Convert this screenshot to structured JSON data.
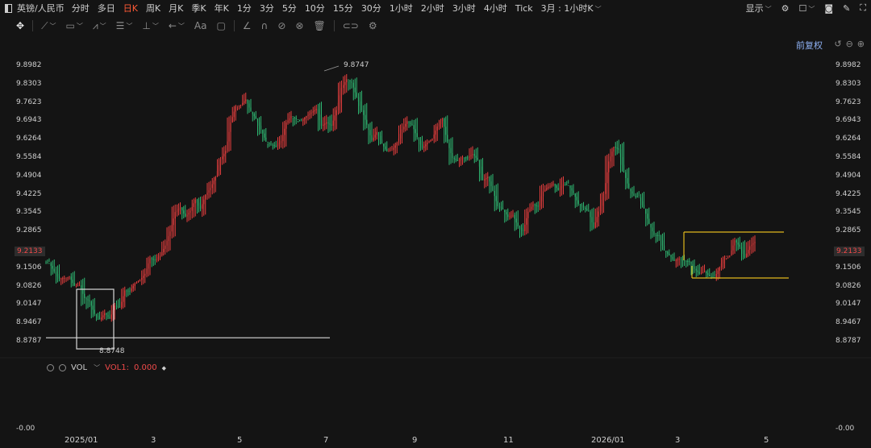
{
  "topbar": {
    "symbol": "英镑/人民币",
    "periods": [
      "分时",
      "多日",
      "日K",
      "周K",
      "月K",
      "季K",
      "年K",
      "1分",
      "3分",
      "5分",
      "10分",
      "15分",
      "30分",
      "1小时",
      "2小时",
      "3小时",
      "4小时",
      "Tick"
    ],
    "active_period": "日K",
    "range_select": "3月 : 1小时K",
    "display_label": "显示"
  },
  "toolbar": {
    "icons": [
      "move-icon",
      "line-tool-icon",
      "rect-tool-icon",
      "pattern-tool-icon",
      "fib-tool-icon",
      "measure-tool-icon",
      "arrow-tool-icon",
      "text-tool-icon",
      "note-tool-icon",
      "brush-icon",
      "magnet-icon",
      "hide-icon",
      "delete-icon",
      "link-icon",
      "settings-icon"
    ],
    "text_tool_label": "Aa"
  },
  "adjust_label": "前复权",
  "price_axis": {
    "ticks": [
      "9.8982",
      "9.8303",
      "9.7623",
      "9.6943",
      "9.6264",
      "9.5584",
      "9.4904",
      "9.4225",
      "9.3545",
      "9.2865",
      "9.2133",
      "9.1506",
      "9.0826",
      "9.0147",
      "8.9467",
      "8.8787"
    ],
    "current_price": "9.2133",
    "vol_zero": "-0.00"
  },
  "x_axis": {
    "ticks": [
      "2025/01",
      "3",
      "5",
      "7",
      "9",
      "11",
      "2026/01",
      "3",
      "5"
    ]
  },
  "annotations": {
    "high_label": "9.8747",
    "low_label": "8.8748"
  },
  "volume": {
    "name": "VOL",
    "indicator_label": "VOL1:",
    "value": "0.000"
  },
  "colors": {
    "up": "#e83e3e",
    "down": "#2eb872",
    "accent": "#ff5a36",
    "box_white": "#d8d8d8",
    "box_yellow": "#e0b81c",
    "blue_link": "#8fb2f5"
  },
  "chart_data": {
    "type": "candlestick",
    "x_ticks": [
      "2025/01",
      "3",
      "5",
      "7",
      "9",
      "11",
      "2026/01",
      "3",
      "5"
    ],
    "y_range": [
      8.8787,
      9.8982
    ],
    "current": 9.2133,
    "swing_high": 9.8747,
    "swing_low": 8.8748,
    "path_points": [
      [
        0,
        9.17
      ],
      [
        3,
        9.12
      ],
      [
        5,
        9.1
      ],
      [
        8,
        9.05
      ],
      [
        10,
        8.95
      ],
      [
        12,
        8.96
      ],
      [
        14,
        9.03
      ],
      [
        16,
        9.06
      ],
      [
        18,
        9.11
      ],
      [
        20,
        9.16
      ],
      [
        22,
        9.2
      ],
      [
        24,
        9.3
      ],
      [
        26,
        9.36
      ],
      [
        28,
        9.38
      ],
      [
        30,
        9.4
      ],
      [
        32,
        9.45
      ],
      [
        34,
        9.53
      ],
      [
        36,
        9.68
      ],
      [
        38,
        9.78
      ],
      [
        40,
        9.73
      ],
      [
        42,
        9.68
      ],
      [
        44,
        9.6
      ],
      [
        46,
        9.65
      ],
      [
        48,
        9.7
      ],
      [
        50,
        9.72
      ],
      [
        52,
        9.73
      ],
      [
        54,
        9.7
      ],
      [
        56,
        9.68
      ],
      [
        58,
        9.8
      ],
      [
        60,
        9.84
      ],
      [
        62,
        9.72
      ],
      [
        64,
        9.65
      ],
      [
        66,
        9.6
      ],
      [
        68,
        9.56
      ],
      [
        70,
        9.68
      ],
      [
        72,
        9.66
      ],
      [
        74,
        9.62
      ],
      [
        76,
        9.64
      ],
      [
        78,
        9.68
      ],
      [
        80,
        9.58
      ],
      [
        82,
        9.57
      ],
      [
        84,
        9.55
      ],
      [
        86,
        9.5
      ],
      [
        88,
        9.45
      ],
      [
        90,
        9.35
      ],
      [
        92,
        9.32
      ],
      [
        94,
        9.31
      ],
      [
        96,
        9.38
      ],
      [
        98,
        9.42
      ],
      [
        100,
        9.44
      ],
      [
        102,
        9.47
      ],
      [
        104,
        9.43
      ],
      [
        106,
        9.37
      ],
      [
        108,
        9.33
      ],
      [
        110,
        9.45
      ],
      [
        112,
        9.62
      ],
      [
        114,
        9.5
      ],
      [
        116,
        9.41
      ],
      [
        118,
        9.36
      ],
      [
        120,
        9.3
      ],
      [
        122,
        9.24
      ],
      [
        124,
        9.2
      ],
      [
        126,
        9.18
      ],
      [
        128,
        9.15
      ],
      [
        130,
        9.14
      ],
      [
        132,
        9.1
      ],
      [
        134,
        9.18
      ],
      [
        136,
        9.24
      ],
      [
        138,
        9.22
      ]
    ],
    "boxes": [
      {
        "color": "white",
        "from_bar": 8,
        "to_bar": 17,
        "low": 8.8748,
        "high": 9.0826
      },
      {
        "color": "yellow",
        "from_bar": 123,
        "to_bar": 140,
        "low": 9.12,
        "high": 9.295
      }
    ],
    "support_line": {
      "value": 8.893,
      "from_bar": 0,
      "to_bar": 72
    },
    "grid": false
  }
}
